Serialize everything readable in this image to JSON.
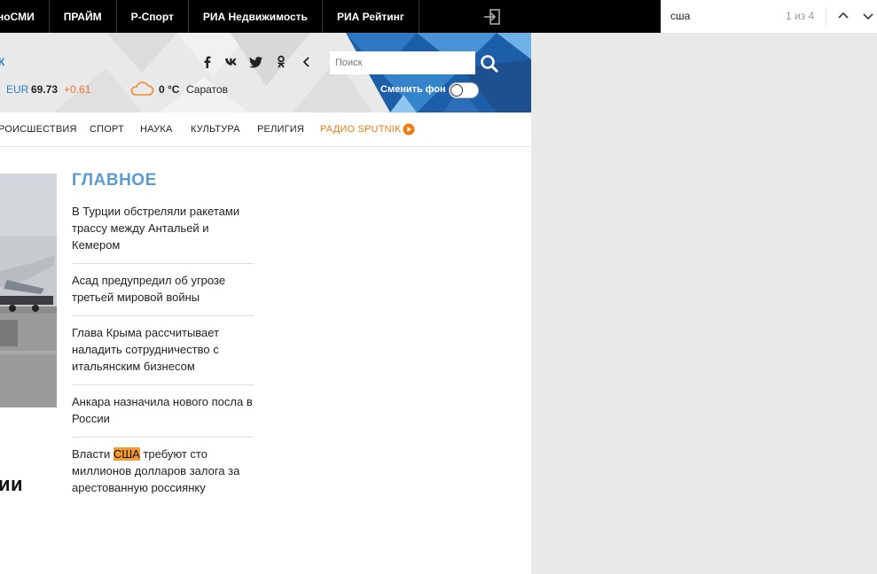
{
  "topnav": {
    "items": [
      "ноСМИ",
      "ПРАЙМ",
      "Р-Спорт",
      "РИА Недвижимость",
      "РИА Рейтинг"
    ]
  },
  "findbar": {
    "query": "сша",
    "count": "1 из 4"
  },
  "header": {
    "cut_text": "К",
    "currency": {
      "label": "EUR",
      "value": "69.73",
      "change": "+0.61"
    },
    "weather": {
      "temp": "0 °C",
      "city": "Саратов"
    },
    "search_placeholder": "Поиск",
    "bg_toggle_label": "Сменить фон",
    "colors": {
      "accent": "#2d7fc1",
      "orange": "#e8742b"
    }
  },
  "categories": [
    "РОИСШЕСТВИЯ",
    "СПОРТ",
    "НАУКА",
    "КУЛЬТУРА",
    "РЕЛИГИЯ",
    "РАДИО SPUTNIK"
  ],
  "main": {
    "headline_cut": "ии",
    "section_title": "ГЛАВНОЕ",
    "news": [
      {
        "text": "В Турции обстреляли ракетами трассу между Антальей и Кемером"
      },
      {
        "text": "Асад предупредил об угрозе третьей мировой войны"
      },
      {
        "text": "Глава Крыма рассчитывает наладить сотрудничество с итальянским бизнесом"
      },
      {
        "text": "Анкара назначила нового посла в России"
      },
      {
        "before": "Власти ",
        "highlight": "США",
        "after": " требуют сто миллионов долларов залога за арестованную россиянку"
      }
    ]
  }
}
